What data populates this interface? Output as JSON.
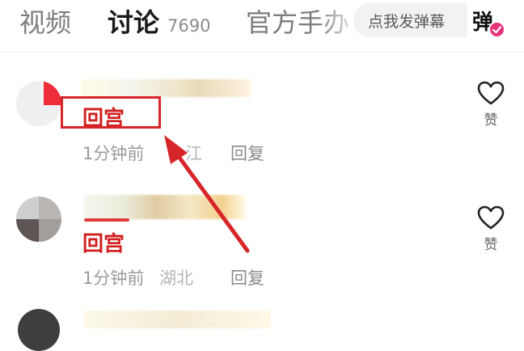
{
  "tabs": {
    "items": [
      {
        "label": "视频",
        "active": false
      },
      {
        "label": "讨论",
        "active": true,
        "count": "7690"
      },
      {
        "label": "官方手办",
        "active": false
      }
    ]
  },
  "danmaku": {
    "placeholder": "点我发弹幕",
    "toggle_label": "弹"
  },
  "comments": [
    {
      "text": "回宫",
      "time": "1分钟前",
      "location": "江",
      "reply_label": "回复",
      "like_label": "赞",
      "highlighted": true
    },
    {
      "text": "回宫",
      "time": "1分钟前",
      "location": "湖北",
      "reply_label": "回复",
      "like_label": "赞",
      "highlighted": false
    }
  ],
  "colors": {
    "accent_red": "#d11f1f",
    "annotation_red": "#d7262a",
    "badge_pink": "#e8347a"
  },
  "icons": {
    "like": "heart-outline-icon",
    "toggle_badge": "check-circle-icon"
  }
}
